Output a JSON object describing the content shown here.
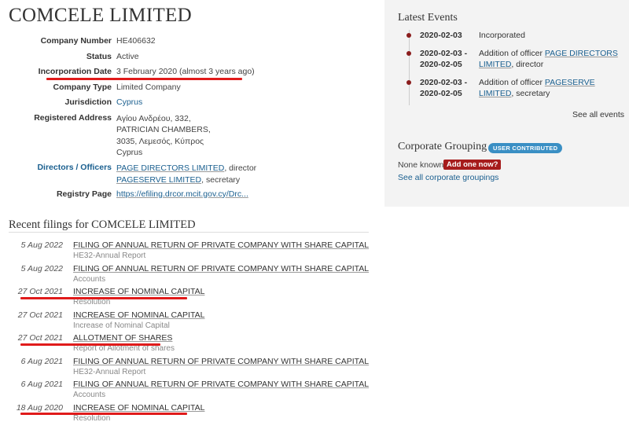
{
  "company": {
    "name": "COMCELE LIMITED",
    "details": [
      {
        "label": "Company Number",
        "value": "HE406632"
      },
      {
        "label": "Status",
        "value": "Active"
      },
      {
        "label": "Incorporation Date",
        "value": "3 February 2020 (almost 3 years ago)"
      },
      {
        "label": "Company Type",
        "value": "Limited Company"
      },
      {
        "label": "Jurisdiction",
        "value": "Cyprus"
      }
    ],
    "address_label": "Registered Address",
    "address_lines": [
      "Αγίου Ανδρέου, 332,",
      "PATRICIAN CHAMBERS,",
      "3035, Λεμεσός, Κύπρος",
      "Cyprus"
    ],
    "officers_label": "Directors / Officers",
    "officers": [
      {
        "name": "PAGE DIRECTORS LIMITED",
        "role": ", director"
      },
      {
        "name": "PAGESERVE LIMITED",
        "role": ", secretary"
      }
    ],
    "registry_label": "Registry Page",
    "registry_url": "https://efiling.drcor.mcit.gov.cy/Drc..."
  },
  "filings": {
    "heading": "Recent filings for COMCELE LIMITED",
    "items": [
      {
        "date": "5 Aug 2022",
        "title": "FILING OF ANNUAL RETURN OF PRIVATE COMPANY WITH SHARE CAPITAL",
        "desc": "HE32-Annual Report"
      },
      {
        "date": "5 Aug 2022",
        "title": "FILING OF ANNUAL RETURN OF PRIVATE COMPANY WITH SHARE CAPITAL",
        "desc": "Accounts"
      },
      {
        "date": "27 Oct 2021",
        "title": "INCREASE OF NOMINAL CAPITAL",
        "desc": "Resolution"
      },
      {
        "date": "27 Oct 2021",
        "title": "INCREASE OF NOMINAL CAPITAL",
        "desc": "Increase of Nominal Capital"
      },
      {
        "date": "27 Oct 2021",
        "title": "ALLOTMENT OF SHARES",
        "desc": "Report of Allotment of shares"
      },
      {
        "date": "6 Aug 2021",
        "title": "FILING OF ANNUAL RETURN OF PRIVATE COMPANY WITH SHARE CAPITAL",
        "desc": "HE32-Annual Report"
      },
      {
        "date": "6 Aug 2021",
        "title": "FILING OF ANNUAL RETURN OF PRIVATE COMPANY WITH SHARE CAPITAL",
        "desc": "Accounts"
      },
      {
        "date": "18 Aug 2020",
        "title": "INCREASE OF NOMINAL CAPITAL",
        "desc": "Resolution"
      }
    ]
  },
  "events": {
    "heading": "Latest Events",
    "items": [
      {
        "date": "2020-02-03",
        "date2": "",
        "text": "Incorporated",
        "link": "",
        "suffix": ""
      },
      {
        "date": "2020-02-03 -",
        "date2": "2020-02-05",
        "text": "Addition of officer ",
        "link": "PAGE DIRECTORS LIMITED",
        "suffix": ", director"
      },
      {
        "date": "2020-02-03 -",
        "date2": "2020-02-05",
        "text": "Addition of officer ",
        "link": "PAGESERVE LIMITED",
        "suffix": ", secretary"
      }
    ],
    "see_all": "See all events"
  },
  "grouping": {
    "heading": "Corporate Grouping",
    "badge": "USER CONTRIBUTED",
    "none_known": "None known.",
    "add_one": "Add one now?",
    "see_all": "See all corporate groupings"
  },
  "colors": {
    "annotation_red": "#e01b1b",
    "link_blue": "#1a5f8f",
    "badge_blue": "#3a8fc4",
    "dot_red": "#8a1c1c"
  }
}
